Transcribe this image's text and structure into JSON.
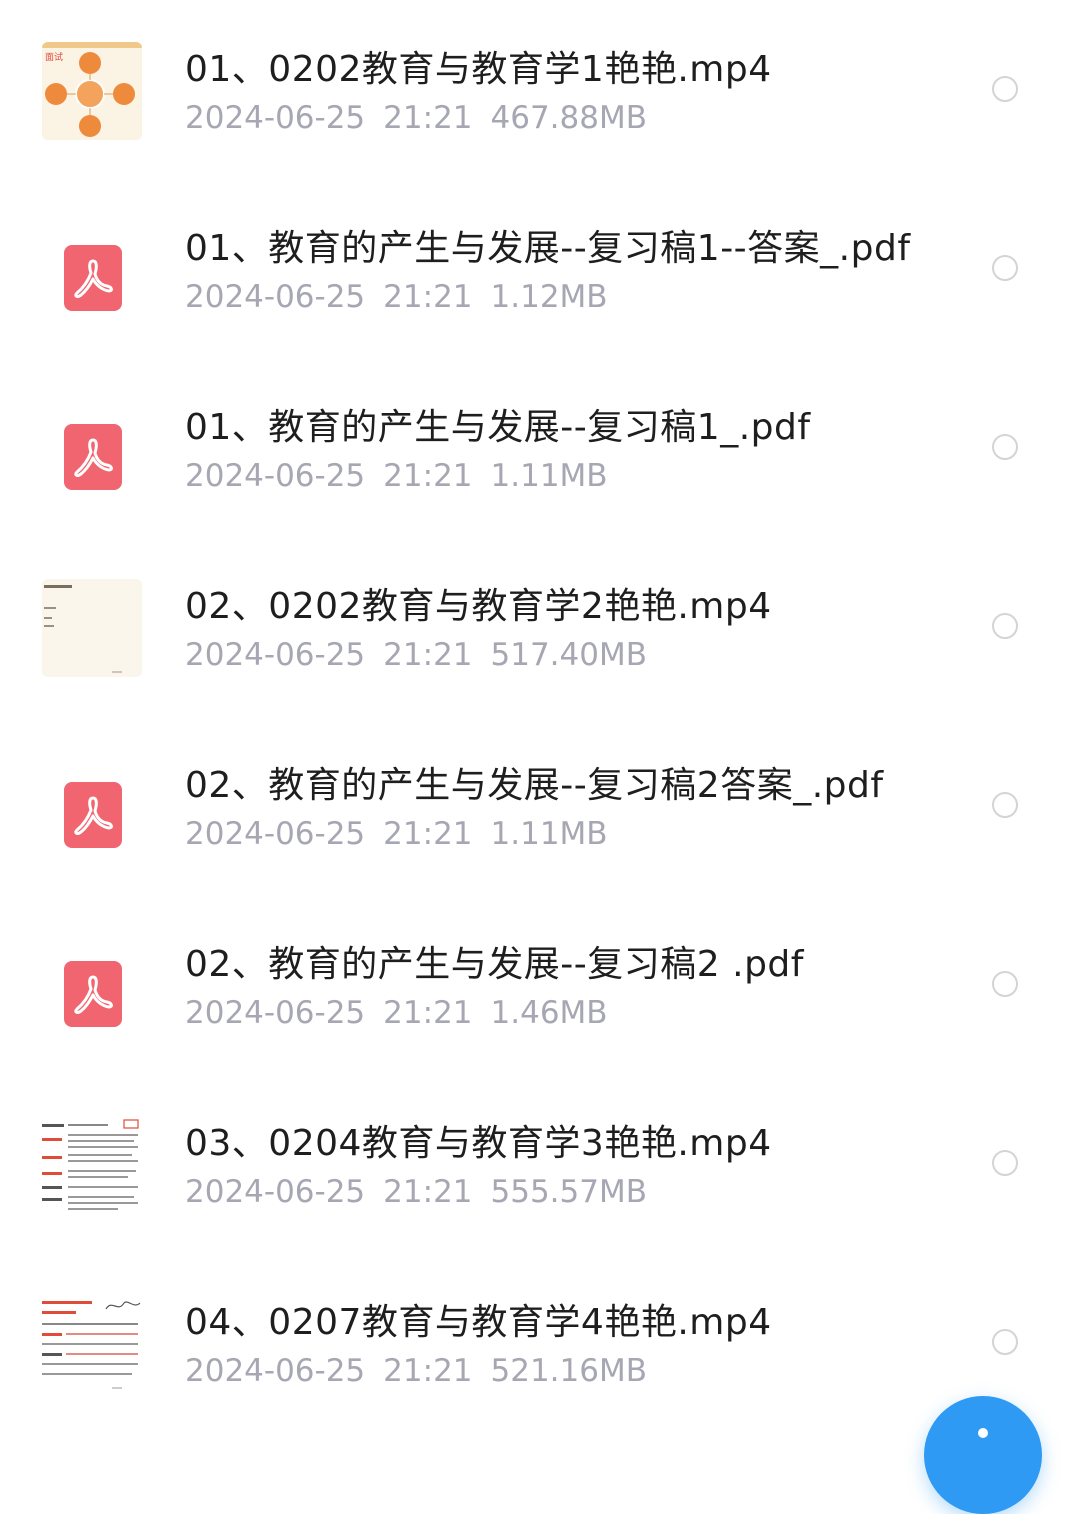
{
  "files": [
    {
      "name": "01、0202教育与教育学1艳艳.mp4",
      "date": "2024-06-25",
      "time": "21:21",
      "size": "467.88MB",
      "type": "video",
      "thumb_icon": "mindmap-thumbnail"
    },
    {
      "name": "01、教育的产生与发展--复习稿1--答案_.pdf",
      "date": "2024-06-25",
      "time": "21:21",
      "size": "1.12MB",
      "type": "pdf",
      "thumb_icon": "pdf-icon"
    },
    {
      "name": "01、教育的产生与发展--复习稿1_.pdf",
      "date": "2024-06-25",
      "time": "21:21",
      "size": "1.11MB",
      "type": "pdf",
      "thumb_icon": "pdf-icon"
    },
    {
      "name": "02、0202教育与教育学2艳艳.mp4",
      "date": "2024-06-25",
      "time": "21:21",
      "size": "517.40MB",
      "type": "video",
      "thumb_icon": "document-thumbnail"
    },
    {
      "name": "02、教育的产生与发展--复习稿2答案_.pdf",
      "date": "2024-06-25",
      "time": "21:21",
      "size": "1.11MB",
      "type": "pdf",
      "thumb_icon": "pdf-icon"
    },
    {
      "name": "02、教育的产生与发展--复习稿2 .pdf",
      "date": "2024-06-25",
      "time": "21:21",
      "size": "1.46MB",
      "type": "pdf",
      "thumb_icon": "pdf-icon"
    },
    {
      "name": "03、0204教育与教育学3艳艳.mp4",
      "date": "2024-06-25",
      "time": "21:21",
      "size": "555.57MB",
      "type": "video",
      "thumb_icon": "notes-thumbnail"
    },
    {
      "name": "04、0207教育与教育学4艳艳.mp4",
      "date": "2024-06-25",
      "time": "21:21",
      "size": "521.16MB",
      "type": "video",
      "thumb_icon": "notes-thumbnail"
    }
  ],
  "colors": {
    "accent": "#2e9af3",
    "pdf_red": "#f0656f",
    "name_text": "#1e1e1e",
    "meta_text": "#a7a7b3",
    "circle_border": "#d4d4d4"
  },
  "fab": {
    "icon": "plus-icon"
  }
}
